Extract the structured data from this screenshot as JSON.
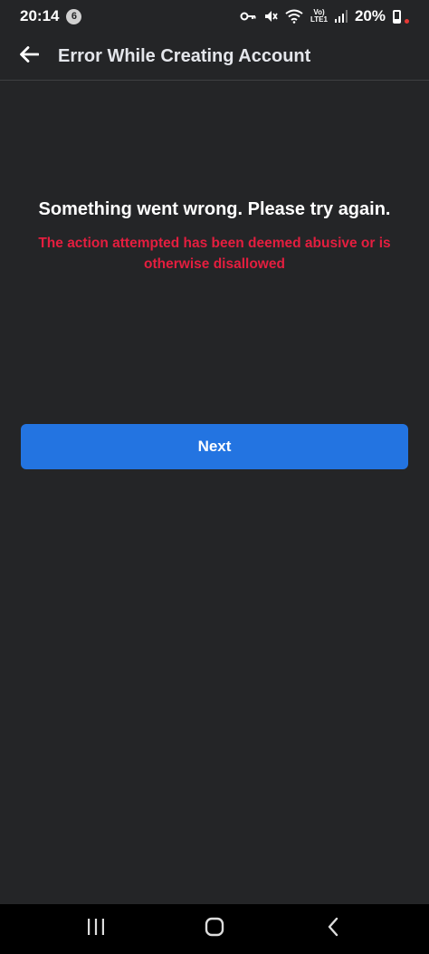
{
  "status_bar": {
    "time": "20:14",
    "notification_count": "6",
    "network_label_top": "Vo)",
    "network_label_bottom": "LTE1",
    "battery_percent": "20%"
  },
  "header": {
    "title": "Error While Creating Account"
  },
  "main": {
    "heading": "Something went wrong. Please try again.",
    "detail": "The action attempted has been deemed abusive or is otherwise disallowed",
    "next_label": "Next"
  },
  "colors": {
    "background": "#242527",
    "primary_button": "#2374e1",
    "error_text": "#e41e3f"
  },
  "icons": {
    "back": "arrow-left-icon",
    "key": "key-icon",
    "mute": "mute-icon",
    "wifi": "wifi-icon",
    "signal": "signal-icon",
    "battery": "battery-icon",
    "recent_apps": "recent-apps-icon",
    "home": "home-icon",
    "nav_back": "chevron-left-icon"
  }
}
